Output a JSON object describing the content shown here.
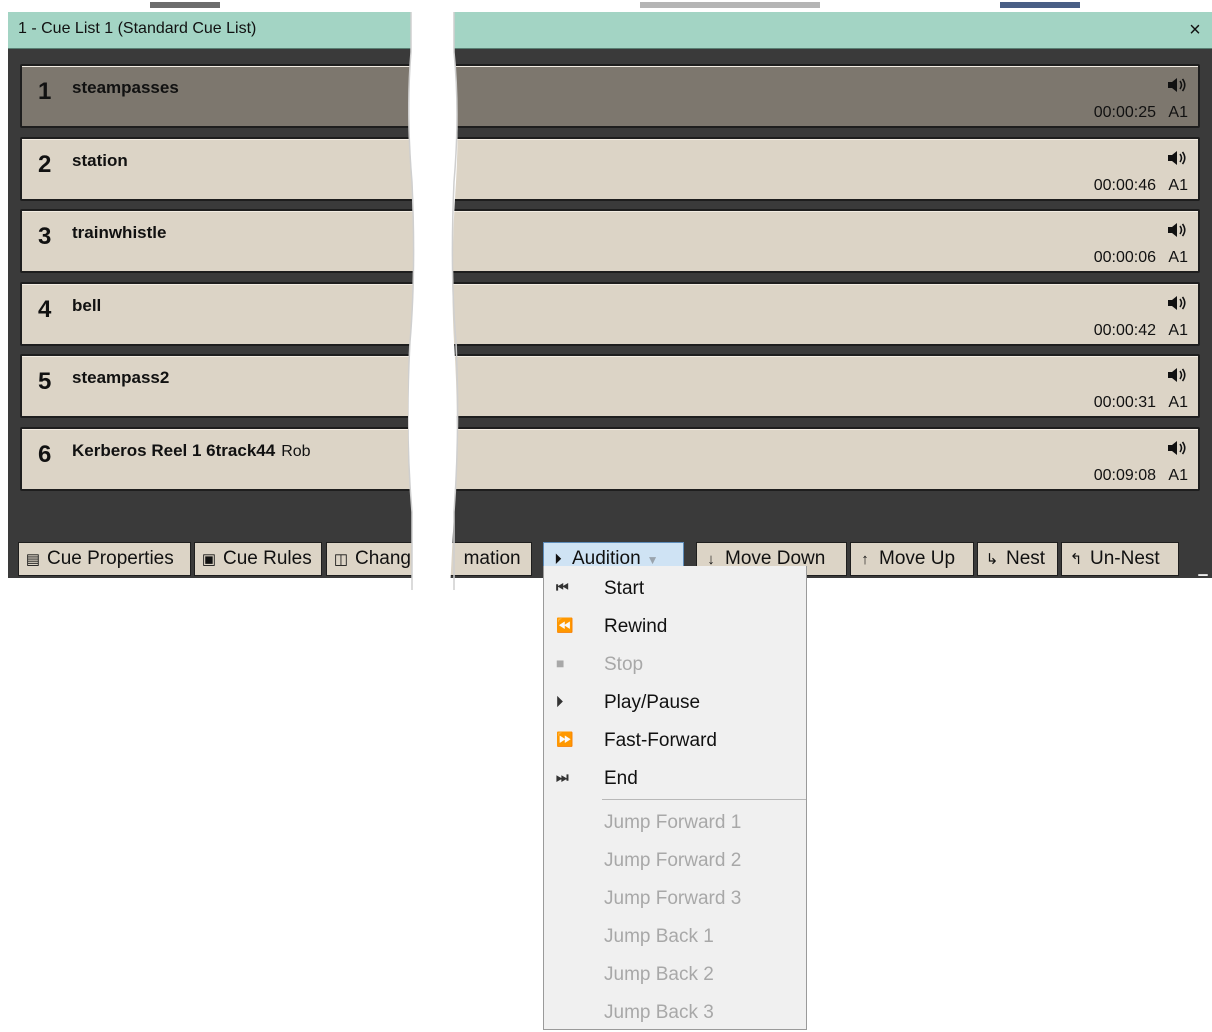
{
  "window": {
    "title": "1 - Cue List 1 (Standard Cue List)",
    "close_glyph": "×"
  },
  "cues": [
    {
      "number": "1",
      "name": "steampasses",
      "extra": "",
      "duration": "00:00:25",
      "output": "A1",
      "icon": "speaker-icon",
      "selected": true
    },
    {
      "number": "2",
      "name": "station",
      "extra": "",
      "duration": "00:00:46",
      "output": "A1",
      "icon": "speaker-icon",
      "selected": false
    },
    {
      "number": "3",
      "name": "trainwhistle",
      "extra": "",
      "duration": "00:00:06",
      "output": "A1",
      "icon": "speaker-icon",
      "selected": false
    },
    {
      "number": "4",
      "name": "bell",
      "extra": "",
      "duration": "00:00:42",
      "output": "A1",
      "icon": "speaker-icon",
      "selected": false
    },
    {
      "number": "5",
      "name": "steampass2",
      "extra": "",
      "duration": "00:00:31",
      "output": "A1",
      "icon": "speaker-icon",
      "selected": false
    },
    {
      "number": "6",
      "name": "Kerberos Reel 1 6track44",
      "extra": "Rob",
      "duration": "00:09:08",
      "output": "A1",
      "icon": "speaker-icon",
      "selected": false
    }
  ],
  "toolbar": {
    "cue_properties": "Cue Properties",
    "cue_rules": "Cue Rules",
    "change_automation_left": "Change",
    "change_automation_right": "mation",
    "audition": "Audition",
    "move_down": "Move Down",
    "move_up": "Move Up",
    "nest": "Nest",
    "un_nest": "Un-Nest",
    "icons": {
      "cue_properties": "properties-icon",
      "cue_rules": "rules-icon",
      "change_automation": "automation-icon",
      "audition": "play-pause-icon",
      "move_down": "arrow-down-icon",
      "move_up": "arrow-up-icon",
      "nest": "nest-icon",
      "un_nest": "un-nest-icon"
    }
  },
  "audition_menu": {
    "items": [
      {
        "label": "Start",
        "icon": "skip-to-start-icon",
        "enabled": true
      },
      {
        "label": "Rewind",
        "icon": "rewind-icon",
        "enabled": true
      },
      {
        "label": "Stop",
        "icon": "stop-icon",
        "enabled": false
      },
      {
        "label": "Play/Pause",
        "icon": "play-pause-icon",
        "enabled": true
      },
      {
        "label": "Fast-Forward",
        "icon": "fast-forward-icon",
        "enabled": true
      },
      {
        "label": "End",
        "icon": "skip-to-end-icon",
        "enabled": true
      },
      {
        "label": "Jump Forward 1",
        "icon": "",
        "enabled": false
      },
      {
        "label": "Jump Forward 2",
        "icon": "",
        "enabled": false
      },
      {
        "label": "Jump Forward 3",
        "icon": "",
        "enabled": false
      },
      {
        "label": "Jump Back 1",
        "icon": "",
        "enabled": false
      },
      {
        "label": "Jump Back 2",
        "icon": "",
        "enabled": false
      },
      {
        "label": "Jump Back 3",
        "icon": "",
        "enabled": false
      }
    ]
  },
  "colors": {
    "titlebar": "#a3d4c4",
    "cue_bg": "#dcd4c6",
    "cue_selected_bg": "#7d776e",
    "window_bg": "#3a3a3a",
    "menu_bg": "#f0f0f0",
    "audition_bg": "#cfe3f4"
  }
}
